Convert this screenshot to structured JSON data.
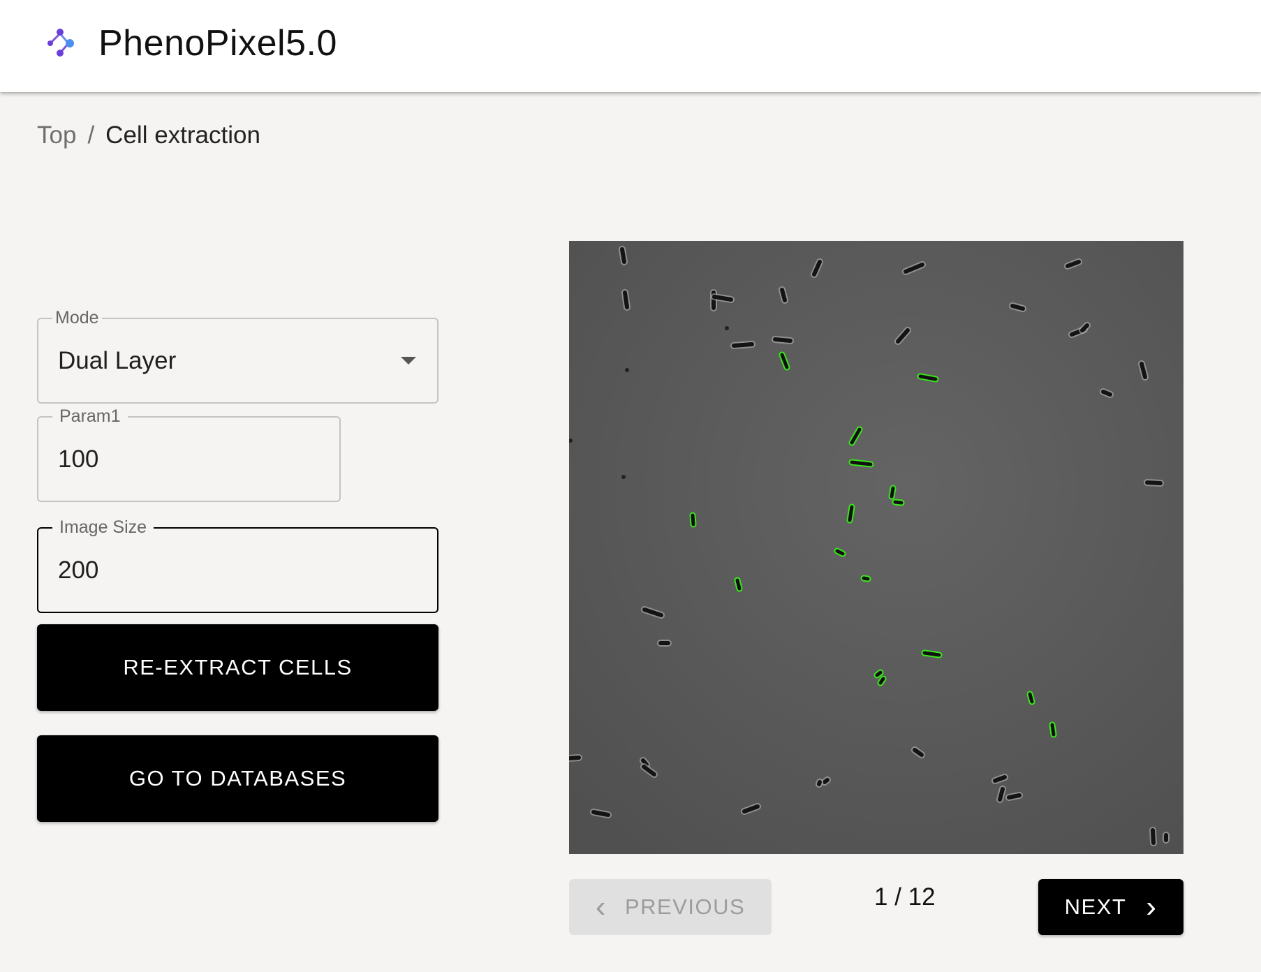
{
  "app": {
    "title": "PhenoPixel5.0",
    "logo_icon": "molecule-logo-icon"
  },
  "breadcrumb": {
    "root": "Top",
    "separator": "/",
    "current": "Cell extraction"
  },
  "form": {
    "mode": {
      "label": "Mode",
      "value": "Dual Layer"
    },
    "param1": {
      "label": "Param1",
      "value": "100"
    },
    "image_size": {
      "label": "Image Size",
      "value": "200"
    }
  },
  "actions": {
    "reextract_label": "RE-EXTRACT CELLS",
    "databases_label": "GO TO DATABASES"
  },
  "viewer": {
    "previous_label": "PREVIOUS",
    "next_label": "NEXT",
    "page_current": 1,
    "page_total": 12,
    "page_indicator": "1 / 12"
  },
  "colors": {
    "accent": "#000000",
    "highlight_outline": "#39e81a",
    "logo_purple": "#6a3fd8",
    "logo_blue": "#4a8ff0"
  }
}
